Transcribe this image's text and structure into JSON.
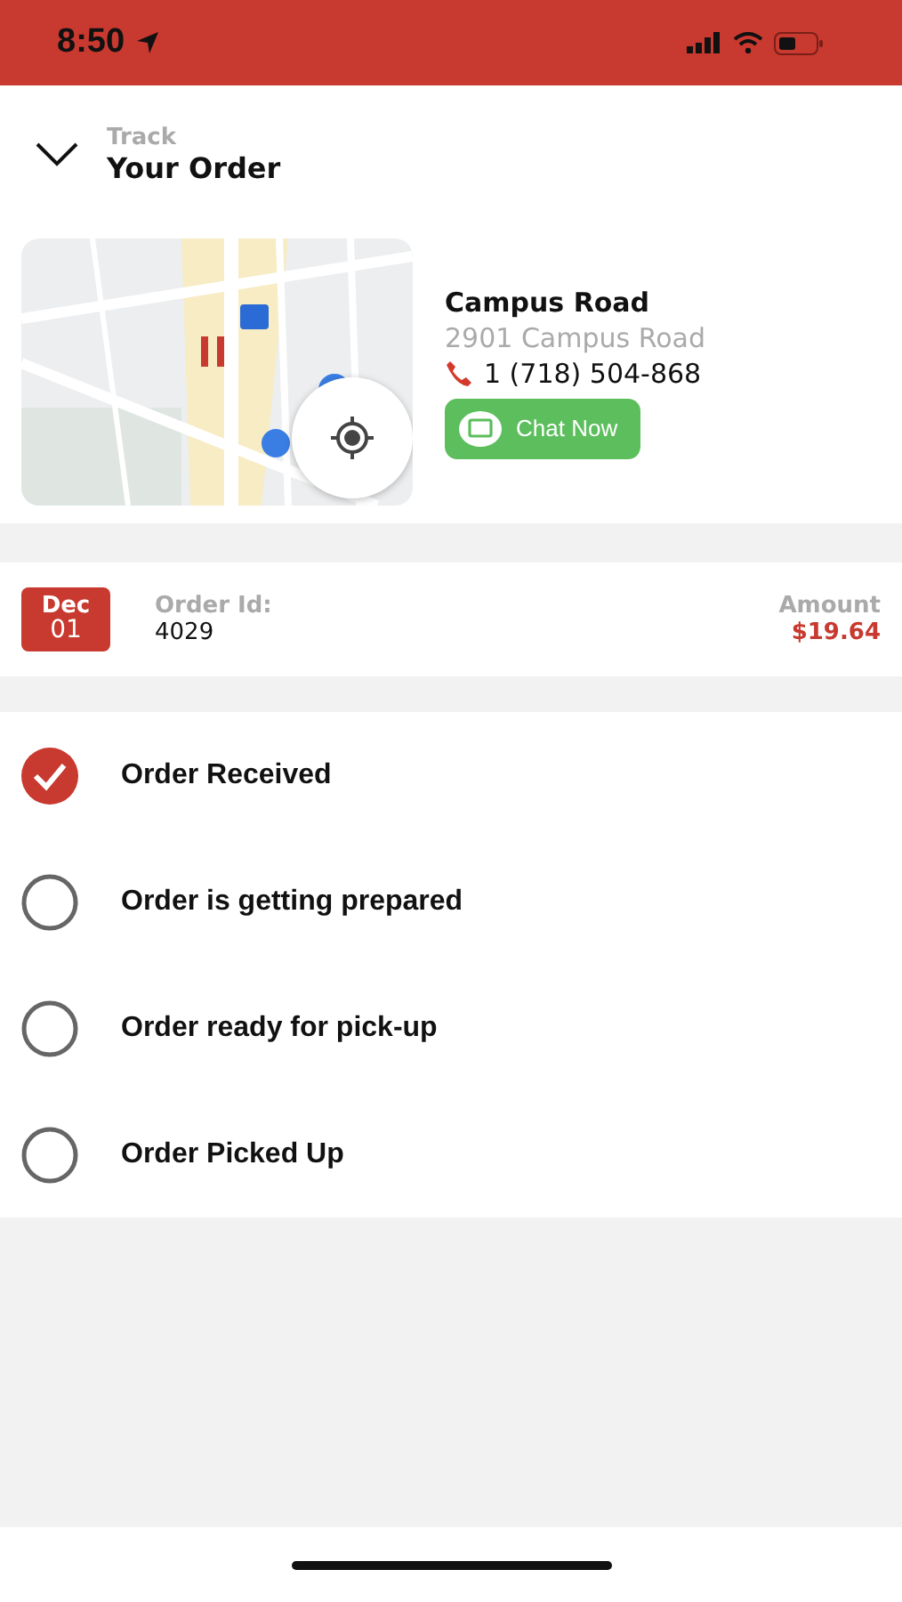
{
  "status_bar": {
    "time": "8:50"
  },
  "header": {
    "subtitle": "Track",
    "title": "Your Order"
  },
  "store": {
    "name": "Campus Road",
    "address": "2901 Campus Road",
    "phone": "1 (718) 504-868",
    "chat_button": "Chat Now"
  },
  "order": {
    "date_month": "Dec",
    "date_day": "01",
    "id_label": "Order Id:",
    "id": "4029",
    "amount_label": "Amount",
    "amount": "$19.64"
  },
  "steps": [
    {
      "label": "Order Received",
      "checked": true
    },
    {
      "label": "Order is getting prepared",
      "checked": false
    },
    {
      "label": "Order ready for pick-up",
      "checked": false
    },
    {
      "label": "Order Picked Up",
      "checked": false
    }
  ]
}
